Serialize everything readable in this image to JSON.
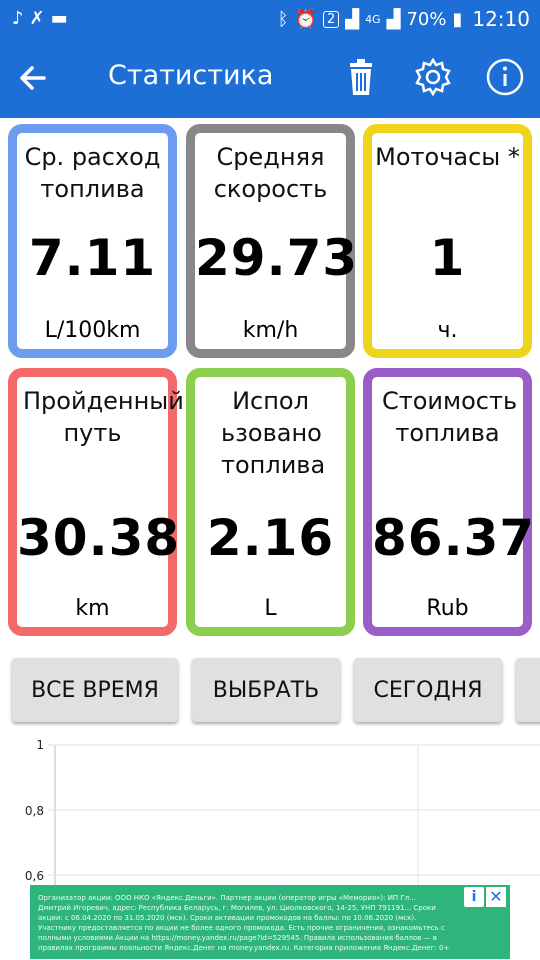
{
  "status_bar": {
    "network": "4G",
    "sim": "2",
    "battery": "70%",
    "time": "12:10"
  },
  "app_bar": {
    "title": "Статистика"
  },
  "cards": [
    {
      "title": "Ср. расход топлива",
      "value": "7.11",
      "unit": "L/100km",
      "color": "#6b9cf0"
    },
    {
      "title": "Средняя скорость",
      "value": "29.73",
      "unit": "km/h",
      "color": "#888888"
    },
    {
      "title": "Моточасы *",
      "value": "1",
      "unit": "ч.",
      "color": "#f0d41c"
    },
    {
      "title": "Пройденный путь",
      "value": "30.38",
      "unit": "km",
      "color": "#f46a6a"
    },
    {
      "title": "Испол ьзовано топлива",
      "value": "2.16",
      "unit": "L",
      "color": "#8ccf4e"
    },
    {
      "title": "Стоимость топлива",
      "value": "86.37",
      "unit": "Rub",
      "color": "#9a5ec9"
    }
  ],
  "filter_buttons": [
    "ВСЕ ВРЕМЯ",
    "ВЫБРАТЬ",
    "СЕГОДНЯ"
  ],
  "chart": {
    "y_ticks": [
      "1",
      "0,8",
      "0,6"
    ]
  },
  "ad": {
    "text": "Организатор акции: ООО НКО «Яндекс.Деньги». Партнер акции (оператор игры «Мемория»): ИП Гл... Дмитрий Игоревич, адрес: Республика Беларусь, г. Могилев, ул. Циолковского, 14-25, УНП 791191... Сроки акции: с 06.04.2020 по 31.05.2020 (мск). Сроки активации промокодов на баллы: по 10.06.2020 (мск). Участнику предоставляется по акции не более одного промокода. Есть прочие ограничения, ознакомьтесь с полными условиями Акции на https://money.yandex.ru/page?id=529545. Правила использования баллов — в правилах программы лояльности Яндекс.Денег на money.yandex.ru. Категория приложения Яндекс.Денег: 0+"
  },
  "colors": {
    "primary": "#1d6fd6",
    "ad_background": "#2fb57c",
    "button_background": "#e0e0e0"
  }
}
